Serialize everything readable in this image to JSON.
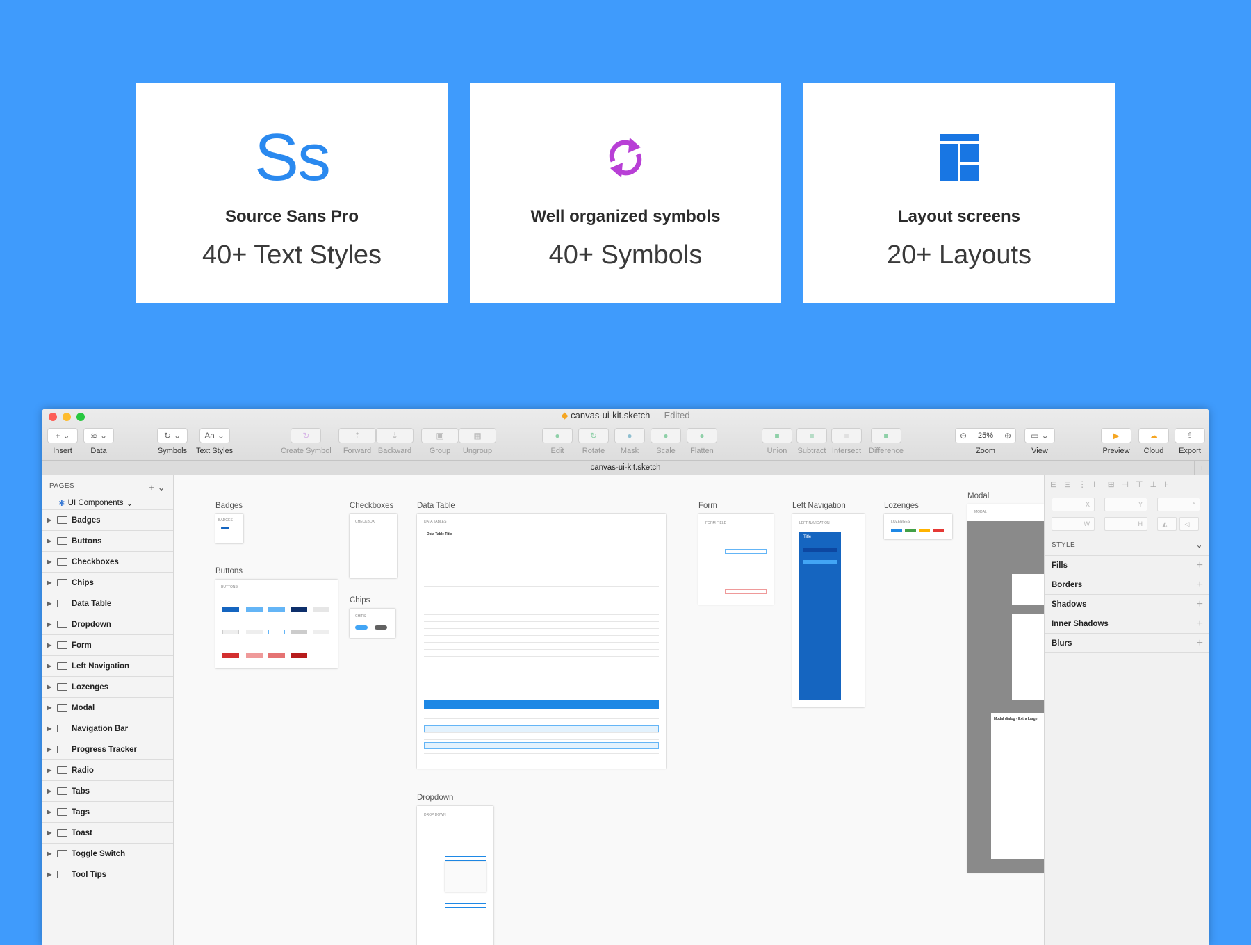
{
  "cards": [
    {
      "icon": "source-sans-icon",
      "glyph": "Ss",
      "title": "Source Sans Pro",
      "subtitle": "40+ Text Styles"
    },
    {
      "icon": "sync-symbols-icon",
      "title": "Well organized symbols",
      "subtitle": "40+ Symbols"
    },
    {
      "icon": "layout-grid-icon",
      "title": "Layout screens",
      "subtitle": "20+ Layouts"
    }
  ],
  "window": {
    "file": "canvas-ui-kit.sketch",
    "status": "— Edited",
    "tab": "canvas-ui-kit.sketch",
    "toolbar": {
      "insert": "Insert",
      "data": "Data",
      "symbols": "Symbols",
      "text_styles": "Text Styles",
      "text_styles_glyph": "Aa",
      "create_symbol": "Create Symbol",
      "forward": "Forward",
      "backward": "Backward",
      "group": "Group",
      "ungroup": "Ungroup",
      "edit": "Edit",
      "rotate": "Rotate",
      "mask": "Mask",
      "scale": "Scale",
      "flatten": "Flatten",
      "union": "Union",
      "subtract": "Subtract",
      "intersect": "Intersect",
      "difference": "Difference",
      "zoom_value": "25%",
      "zoom": "Zoom",
      "view": "View",
      "preview": "Preview",
      "cloud": "Cloud",
      "export": "Export"
    }
  },
  "sidebar": {
    "header": "PAGES",
    "current_page": "UI Components",
    "items": [
      "Badges",
      "Buttons",
      "Checkboxes",
      "Chips",
      "Data Table",
      "Dropdown",
      "Form",
      "Left Navigation",
      "Lozenges",
      "Modal",
      "Navigation Bar",
      "Progress Tracker",
      "Radio",
      "Tabs",
      "Tags",
      "Toast",
      "Toggle Switch",
      "Tool Tips"
    ]
  },
  "artboards": {
    "badges": "Badges",
    "buttons": "Buttons",
    "checkboxes": "Checkboxes",
    "chips": "Chips",
    "data_table": "Data Table",
    "dropdown": "Dropdown",
    "form": "Form",
    "left_navigation": "Left Navigation",
    "lozenges": "Lozenges",
    "modal": "Modal",
    "mini": {
      "badges": "BADGES",
      "buttons": "BUTTONS",
      "checkbox": "CHECKBOX",
      "chips": "CHIPS",
      "data_tables": "DATA TABLES",
      "table_title": "Data Table Title",
      "form_field": "FORM FIELD",
      "left_nav": "LEFT NAVIGATION",
      "lozenges": "LOZENGES",
      "modal": "MODAL",
      "dropdown": "DROP DOWN",
      "nav_title": "Title",
      "modal_xl": "Modal dialog - Extra Large"
    }
  },
  "inspector": {
    "x": "X",
    "y": "Y",
    "w": "W",
    "h": "H",
    "deg": "°",
    "style": "STYLE",
    "rows": [
      "Fills",
      "Borders",
      "Shadows",
      "Inner Shadows",
      "Blurs"
    ]
  },
  "colors": {
    "background": "#3f9bfc",
    "accent": "#2a89ef",
    "symbol_icon": "#b83fd6"
  }
}
